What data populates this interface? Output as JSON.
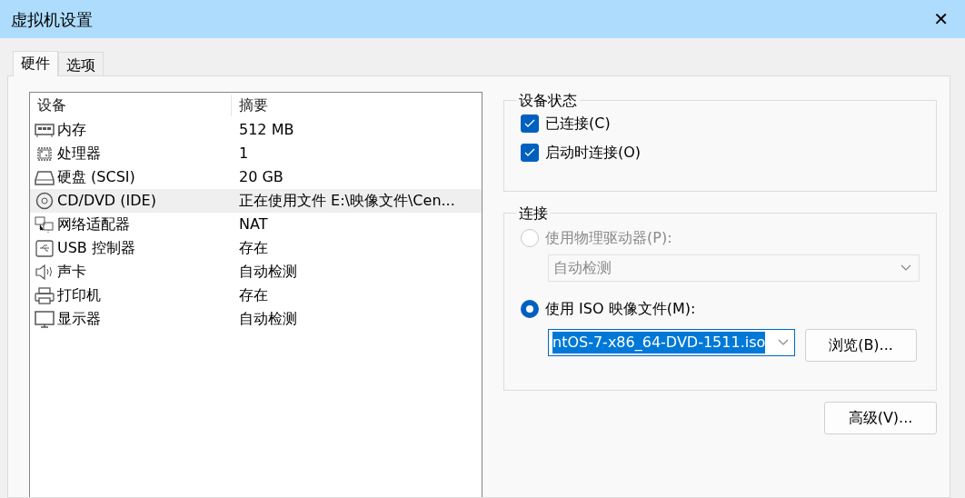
{
  "window": {
    "title": "虚拟机设置",
    "close": "✕"
  },
  "tabs": [
    {
      "label": "硬件",
      "selected": true
    },
    {
      "label": "选项",
      "selected": false
    }
  ],
  "devices": {
    "columns": [
      "设备",
      "摘要"
    ],
    "rows": [
      {
        "kind": "memory",
        "name": "内存",
        "summary": "512 MB",
        "selected": false
      },
      {
        "kind": "cpu",
        "name": "处理器",
        "summary": "1",
        "selected": false
      },
      {
        "kind": "disk",
        "name": "硬盘 (SCSI)",
        "summary": "20 GB",
        "selected": false
      },
      {
        "kind": "cdrom",
        "name": "CD/DVD (IDE)",
        "summary": "正在使用文件 E:\\映像文件\\Cen...",
        "selected": true
      },
      {
        "kind": "network",
        "name": "网络适配器",
        "summary": "NAT",
        "selected": false
      },
      {
        "kind": "usb",
        "name": "USB 控制器",
        "summary": "存在",
        "selected": false
      },
      {
        "kind": "sound",
        "name": "声卡",
        "summary": "自动检测",
        "selected": false
      },
      {
        "kind": "printer",
        "name": "打印机",
        "summary": "存在",
        "selected": false
      },
      {
        "kind": "display",
        "name": "显示器",
        "summary": "自动检测",
        "selected": false
      }
    ]
  },
  "device_status": {
    "title": "设备状态",
    "checkboxes": [
      {
        "label": "已连接(C)",
        "checked": true
      },
      {
        "label": "启动时连接(O)",
        "checked": true
      }
    ]
  },
  "connection": {
    "title": "连接",
    "physical": {
      "label": "使用物理驱动器(P):",
      "selected": false,
      "disabled": true,
      "value": "自动检测"
    },
    "iso": {
      "label": "使用 ISO 映像文件(M):",
      "selected": true,
      "disabled": false,
      "value": "ntOS-7-x86_64-DVD-1511.iso",
      "browse": "浏览(B)..."
    }
  },
  "advanced_button": "高级(V)..."
}
